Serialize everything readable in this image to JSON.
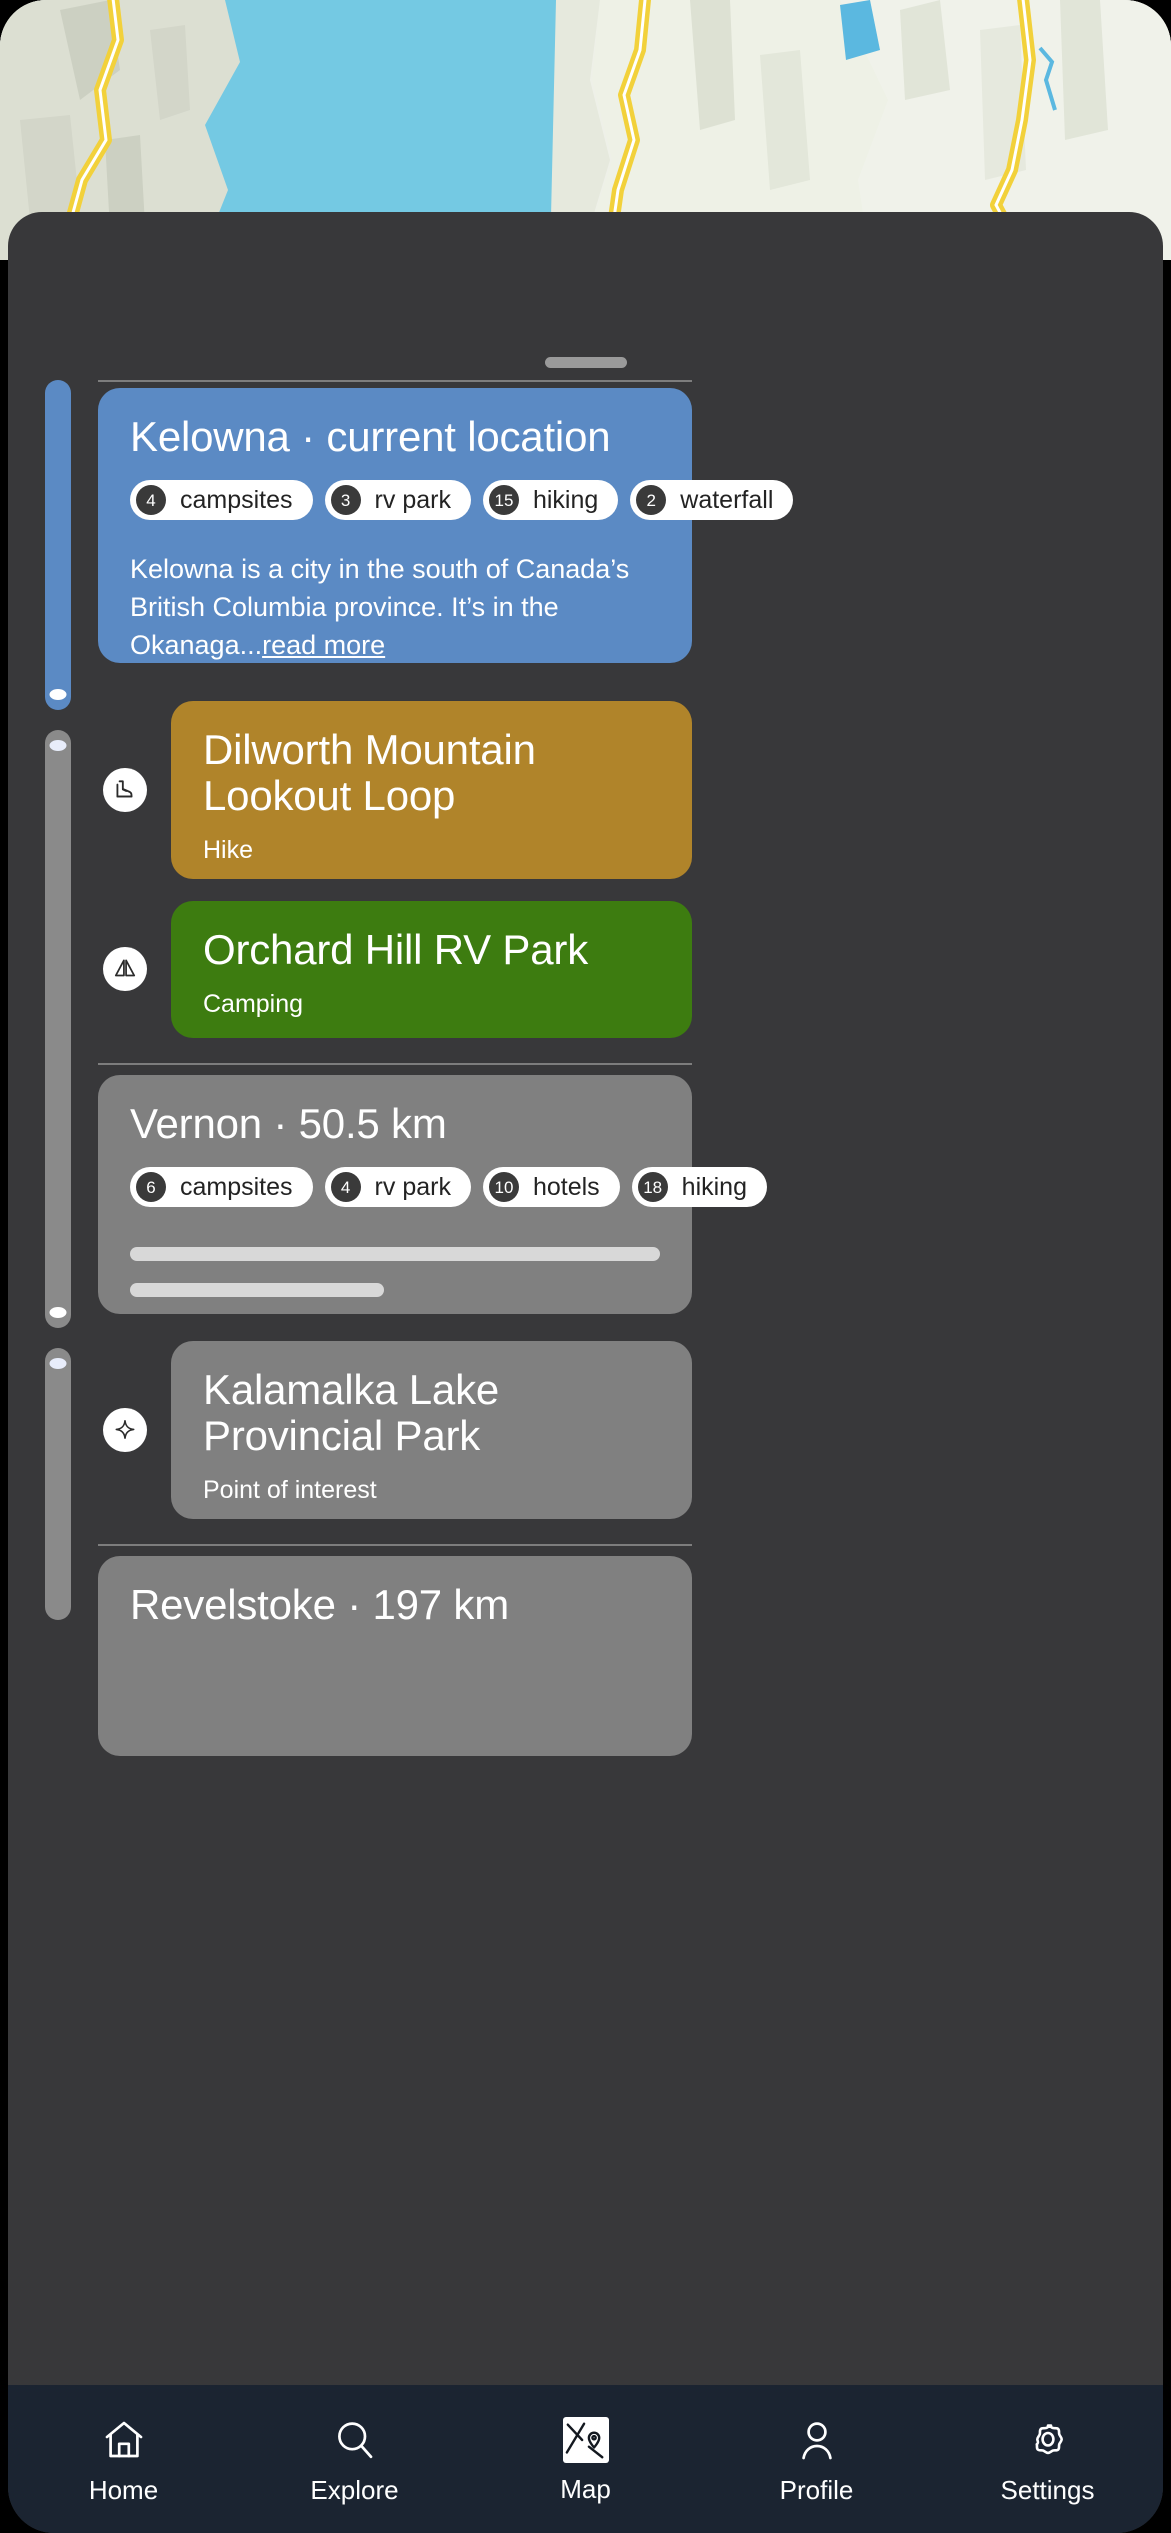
{
  "colors": {
    "sheet_bg": "#38383a",
    "current_card": "#5b8ac4",
    "hike_card": "#b0842a",
    "camp_card": "#3d7c10",
    "muted_card": "#808080",
    "nav_bg": "#1b2431",
    "rail_active": "#5b8ac4",
    "rail_inactive": "#8a8a8a"
  },
  "map": {
    "name": "map-background",
    "water_color": "#74c9e3",
    "road_color": "#f2d13b",
    "land_color": "#eef0e8"
  },
  "sheet": {
    "grabber": "drag-handle"
  },
  "cards": [
    {
      "id": "kelowna",
      "title": "Kelowna · current location",
      "type": "city-current",
      "chips": [
        {
          "count": "4",
          "label": "campsites"
        },
        {
          "count": "3",
          "label": "rv park"
        },
        {
          "count": "15",
          "label": "hiking"
        },
        {
          "count": "2",
          "label": "waterfall"
        }
      ],
      "description": "Kelowna is a city in the south of Canada’s British Columbia province. It’s in the Okanaga...",
      "read_more": "read more"
    },
    {
      "id": "dilworth",
      "title": "Dilworth Mountain Lookout Loop",
      "subtitle": "Hike",
      "icon": "hiking-boot-icon"
    },
    {
      "id": "orchard-hill",
      "title": "Orchard Hill RV Park",
      "subtitle": "Camping",
      "icon": "tent-icon"
    },
    {
      "id": "vernon",
      "title": "Vernon · 50.5 km",
      "type": "city",
      "chips": [
        {
          "count": "6",
          "label": "campsites"
        },
        {
          "count": "4",
          "label": "rv park"
        },
        {
          "count": "10",
          "label": "hotels"
        },
        {
          "count": "18",
          "label": "hiking"
        }
      ]
    },
    {
      "id": "kalamalka",
      "title": "Kalamalka Lake Provincial Park",
      "subtitle": "Point of interest",
      "icon": "sparkle-icon"
    },
    {
      "id": "revelstoke",
      "title": "Revelstoke · 197 km",
      "type": "city"
    }
  ],
  "nav": {
    "items": [
      {
        "label": "Home",
        "icon": "home-icon",
        "active": false
      },
      {
        "label": "Explore",
        "icon": "search-icon",
        "active": false
      },
      {
        "label": "Map",
        "icon": "map-pin-icon",
        "active": true
      },
      {
        "label": "Profile",
        "icon": "person-icon",
        "active": false
      },
      {
        "label": "Settings",
        "icon": "gear-icon",
        "active": false
      }
    ]
  }
}
